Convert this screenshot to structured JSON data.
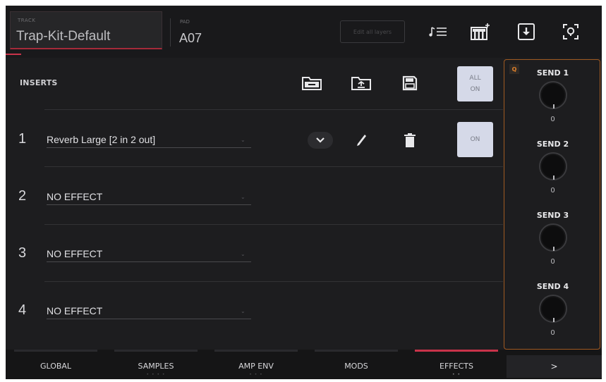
{
  "header": {
    "track_caption": "TRACK",
    "track_name": "Trap-Kit-Default",
    "pad_caption": "PAD",
    "pad_value": "A07",
    "edit_layers_label": "Edit all layers"
  },
  "inserts": {
    "label": "INSERTS",
    "all_on_line1": "ALL",
    "all_on_line2": "ON",
    "slots": [
      {
        "number": "1",
        "name": "Reverb Large [2 in 2 out]",
        "state": "ON"
      },
      {
        "number": "2",
        "name": "NO EFFECT"
      },
      {
        "number": "3",
        "name": "NO EFFECT"
      },
      {
        "number": "4",
        "name": "NO EFFECT"
      }
    ]
  },
  "sends": {
    "badge": "Q",
    "items": [
      {
        "label": "SEND 1",
        "value": "0"
      },
      {
        "label": "SEND 2",
        "value": "0"
      },
      {
        "label": "SEND 3",
        "value": "0"
      },
      {
        "label": "SEND 4",
        "value": "0"
      }
    ]
  },
  "tabs": [
    {
      "label": "GLOBAL",
      "dots": ""
    },
    {
      "label": "SAMPLES",
      "dots": "• • • •"
    },
    {
      "label": "AMP ENV",
      "dots": "• • •"
    },
    {
      "label": "MODS",
      "dots": ""
    },
    {
      "label": "EFFECTS",
      "dots": "• •"
    }
  ],
  "next_label": ">",
  "colors": {
    "accent_red": "#c8334a",
    "sends_border": "#a05a22",
    "on_button": "#d5d9e8"
  }
}
